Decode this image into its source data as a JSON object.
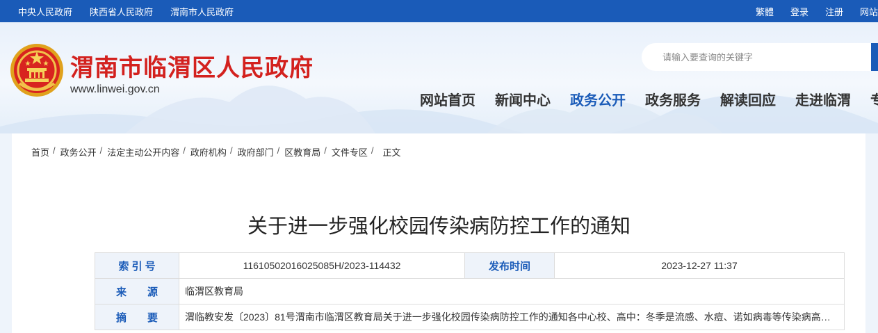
{
  "topbar": {
    "links": [
      "中央人民政府",
      "陕西省人民政府",
      "渭南市人民政府"
    ],
    "right_links": [
      "繁體",
      "登录",
      "注册",
      "网站"
    ]
  },
  "header": {
    "site_name": "渭南市临渭区人民政府",
    "site_url": "www.linwei.gov.cn",
    "emblem_icon": "national-emblem-icon"
  },
  "search": {
    "placeholder": "请输入要查询的关键字"
  },
  "nav": {
    "items": [
      "网站首页",
      "新闻中心",
      "政务公开",
      "政务服务",
      "解读回应",
      "走进临渭",
      "专"
    ],
    "active": "政务公开"
  },
  "breadcrumb": {
    "items": [
      "首页",
      "政务公开",
      "法定主动公开内容",
      "政府机构",
      "政府部门",
      "区教育局",
      "文件专区",
      "正文"
    ],
    "separator": "/"
  },
  "document": {
    "title": "关于进一步强化校园传染病防控工作的通知",
    "index_label": "索 引 号",
    "index_value": "11610502016025085H/2023-114432",
    "date_label": "发布时间",
    "date_value": "2023-12-27 11:37",
    "source_label": "来　　源",
    "source_value": "临渭区教育局",
    "summary_label": "摘　　要",
    "summary_value": "渭临教安发〔2023〕81号渭南市临渭区教育局关于进一步强化校园传染病防控工作的通知各中心校、高中：冬季是流感、水痘、诺如病毒等传染病高发季节"
  },
  "colors": {
    "topbar": "#1a5bb8",
    "title_red": "#d3211e",
    "nav_active": "#1a5bb8",
    "label_bg": "#eef3fa"
  }
}
